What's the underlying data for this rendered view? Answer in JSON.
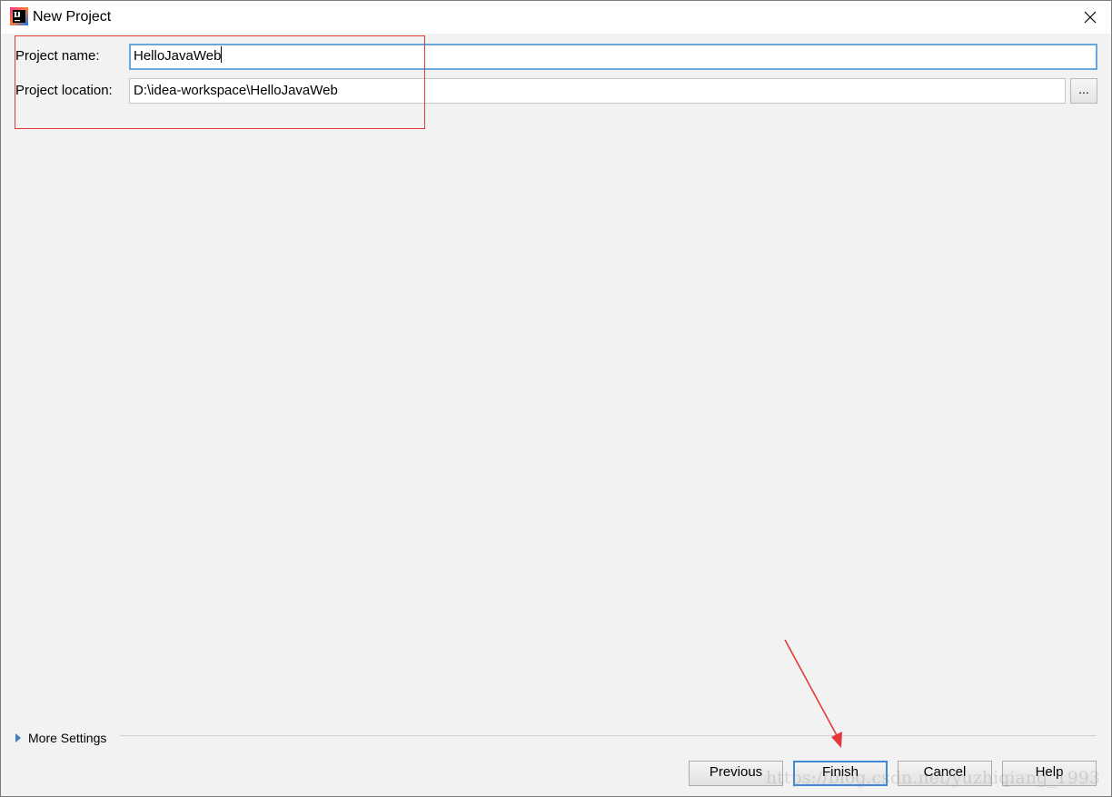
{
  "window": {
    "title": "New Project",
    "icon": "intellij-idea-icon",
    "close_icon": "close-icon"
  },
  "form": {
    "project_name_label": "Project name:",
    "project_name_value": "HelloJavaWeb",
    "project_location_label": "Project location:",
    "project_location_value": "D:\\idea-workspace\\HelloJavaWeb",
    "browse_label": "..."
  },
  "more_settings": {
    "label": "More Settings"
  },
  "buttons": {
    "previous": "Previous",
    "finish": "Finish",
    "cancel": "Cancel",
    "help": "Help"
  },
  "watermark": "https://blog.csdn.net/yuzhiqiang_1993",
  "colors": {
    "annotation_red": "#e23a3a",
    "focus_blue": "#6aa8dc",
    "default_button_border": "#3f8ad3",
    "dialog_background": "#f2f2f2"
  }
}
